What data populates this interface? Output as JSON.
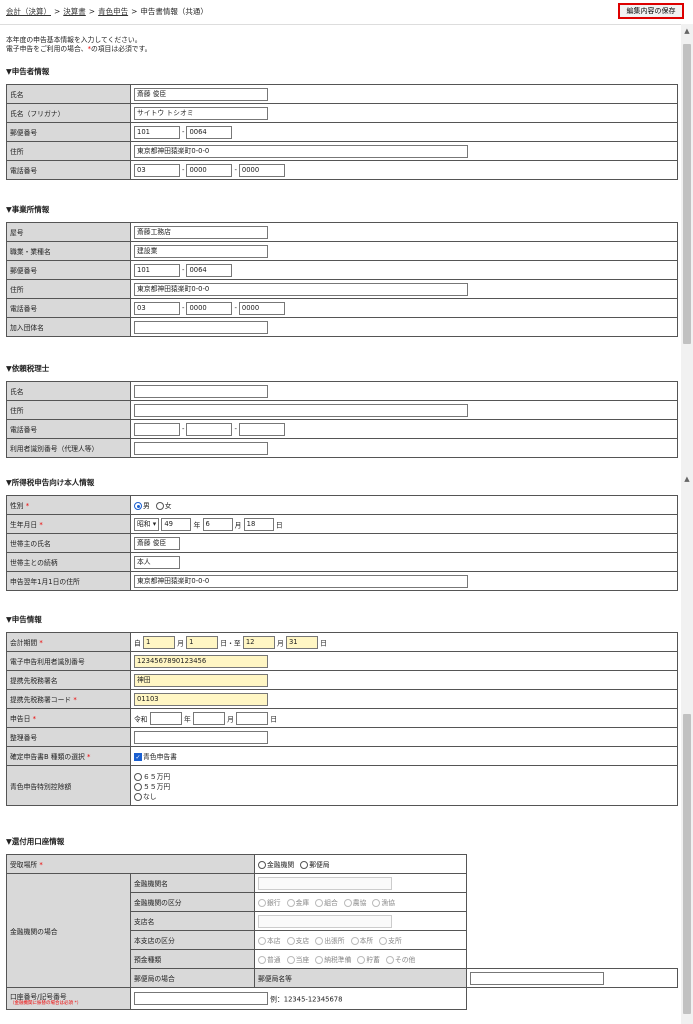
{
  "breadcrumb": {
    "items": [
      "会計（決算）",
      "決算書",
      "青色申告"
    ],
    "current": "申告書情報（共通）",
    "separator": ">"
  },
  "save_button": "編集内容の保存",
  "intro": {
    "line1": "本年度の申告基本情報を入力してください。",
    "line2_a": "電子申告をご利用の場合、",
    "line2_b": "の項目は必須です。",
    "required_mark": "*"
  },
  "sections": {
    "filer": {
      "title": "▼申告者情報",
      "name_label": "氏名",
      "name": "斎藤 俊臣",
      "kana_label": "氏名（フリガナ）",
      "kana": "サイトウ トシオミ",
      "zip_label": "郵便番号",
      "zip1": "101",
      "zip2": "0064",
      "addr_label": "住所",
      "addr": "東京都神田猿楽町0-0-0",
      "tel_label": "電話番号",
      "tel1": "03",
      "tel2": "0000",
      "tel3": "0000"
    },
    "office": {
      "title": "▼事業所情報",
      "shop_label": "屋号",
      "shop": "斎藤工務店",
      "job_label": "職業・業種名",
      "job": "建設業",
      "zip_label": "郵便番号",
      "zip1": "101",
      "zip2": "0064",
      "addr_label": "住所",
      "addr": "東京都神田猿楽町0-0-0",
      "tel_label": "電話番号",
      "tel1": "03",
      "tel2": "0000",
      "tel3": "0000",
      "group_label": "加入団体名",
      "group": ""
    },
    "accountant": {
      "title": "▼依頼税理士",
      "name_label": "氏名",
      "addr_label": "住所",
      "tel_label": "電話番号",
      "id_label": "利用者識別番号（代理人等）"
    },
    "personal": {
      "title": "▼所得税申告向け本人情報",
      "sex_label": "性別",
      "male": "男",
      "female": "女",
      "birth_label": "生年月日",
      "era": "昭和",
      "year": "49",
      "year_unit": "年",
      "month": "6",
      "month_unit": "月",
      "day": "18",
      "day_unit": "日",
      "head_label": "世帯主の氏名",
      "head": "斎藤 俊臣",
      "rel_label": "世帯主との続柄",
      "rel": "本人",
      "jan_addr_label": "申告翌年1月1日の住所",
      "jan_addr": "東京都神田猿楽町0-0-0"
    },
    "filing": {
      "title": "▼申告情報",
      "period_label": "会計期間",
      "from_word": "自",
      "from_m": "1",
      "m_unit": "月",
      "from_d": "1",
      "d_unit_to": "日・至",
      "to_m": "12",
      "to_d": "31",
      "d_unit": "日",
      "eid_label": "電子申告利用者識別番号",
      "eid": "1234567890123456",
      "office_label": "提携先税務署名",
      "office": "神田",
      "code_label": "提携先税務署コード",
      "code": "01103",
      "date_label": "申告日",
      "era": "令和",
      "y_unit": "年",
      "m_unit2": "月",
      "d_unit2": "日",
      "ref_label": "整理番号",
      "form_label": "確定申告書B 種類の選択",
      "form_value": "青色申告書",
      "deduct_label": "青色申告特別控除額",
      "deduct_opts": [
        "６５万円",
        "５５万円",
        "なし"
      ]
    },
    "refund": {
      "title": "▼還付用口座情報",
      "place_label": "受取場所",
      "place_opts": [
        "金融機関",
        "郵便局"
      ],
      "bank_label": "金融機関の場合",
      "bank_name_label": "金融機関名",
      "bank_type_label": "金融機関の区分",
      "bank_types": [
        "銀行",
        "金庫",
        "組合",
        "農協",
        "漁協"
      ],
      "branch_label": "支店名",
      "branch_type_label": "本支店の区分",
      "branch_types": [
        "本店",
        "支店",
        "出張所",
        "本所",
        "支所"
      ],
      "deposit_label": "預金種類",
      "deposit_types": [
        "普通",
        "当座",
        "納税準備",
        "貯蓄",
        "その他"
      ],
      "post_label": "郵便局の場合",
      "post_name_label": "郵便局名等",
      "acct_label": "口座番号/記号番号",
      "acct_note": "（金融機関に振替の場合は必須",
      "acct_example": "例：12345-12345678"
    }
  }
}
